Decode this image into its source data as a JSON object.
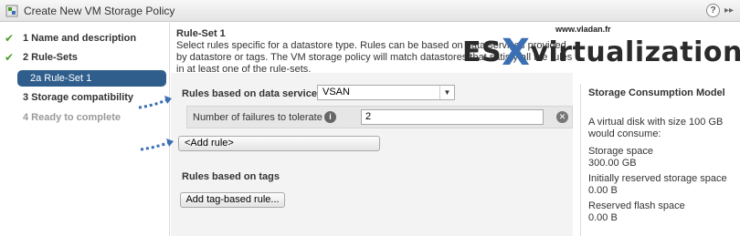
{
  "window": {
    "title": "Create New VM Storage Policy",
    "help_label": "?",
    "expand_label": "▸▸"
  },
  "wizard": {
    "steps": [
      {
        "label": "1  Name and description",
        "done": true
      },
      {
        "label": "2  Rule-Sets",
        "done": true
      },
      {
        "label": "2a  Rule-Set 1",
        "active": true
      },
      {
        "label": "3  Storage compatibility",
        "done": false
      },
      {
        "label": "4  Ready to complete",
        "disabled": true
      }
    ]
  },
  "main": {
    "heading": "Rule-Set 1",
    "description": "Select rules specific for a datastore type. Rules can be based on data services provided by datastore or tags. The VM storage policy will match datastores that satisfy all the rules in at least one of the rule-sets.",
    "rules_data_services_label": "Rules based on data services",
    "data_service_value": "VSAN",
    "failures_label": "Number of failures to tolerate",
    "failures_value": "2",
    "add_rule_label": "<Add rule>",
    "rules_tags_label": "Rules based on tags",
    "add_tag_rule_label": "Add tag-based rule..."
  },
  "watermark": {
    "url": "www.vladan.fr",
    "prefix": "ES",
    "x": "X",
    "suffix": "virtualization"
  },
  "storage_model": {
    "title": "Storage Consumption Model",
    "intro_line1": "A virtual disk with size 100 GB",
    "intro_line2": "would consume:",
    "storage_space_label": "Storage space",
    "storage_space_value": "300.00 GB",
    "reserved_label": "Initially reserved storage space",
    "reserved_value": "0.00 B",
    "flash_label": "Reserved flash space",
    "flash_value": "0.00 B"
  },
  "colors": {
    "accent": "#2f5e8c",
    "check_green": "#4a9d2a",
    "arrow_blue": "#3a6fb4"
  }
}
